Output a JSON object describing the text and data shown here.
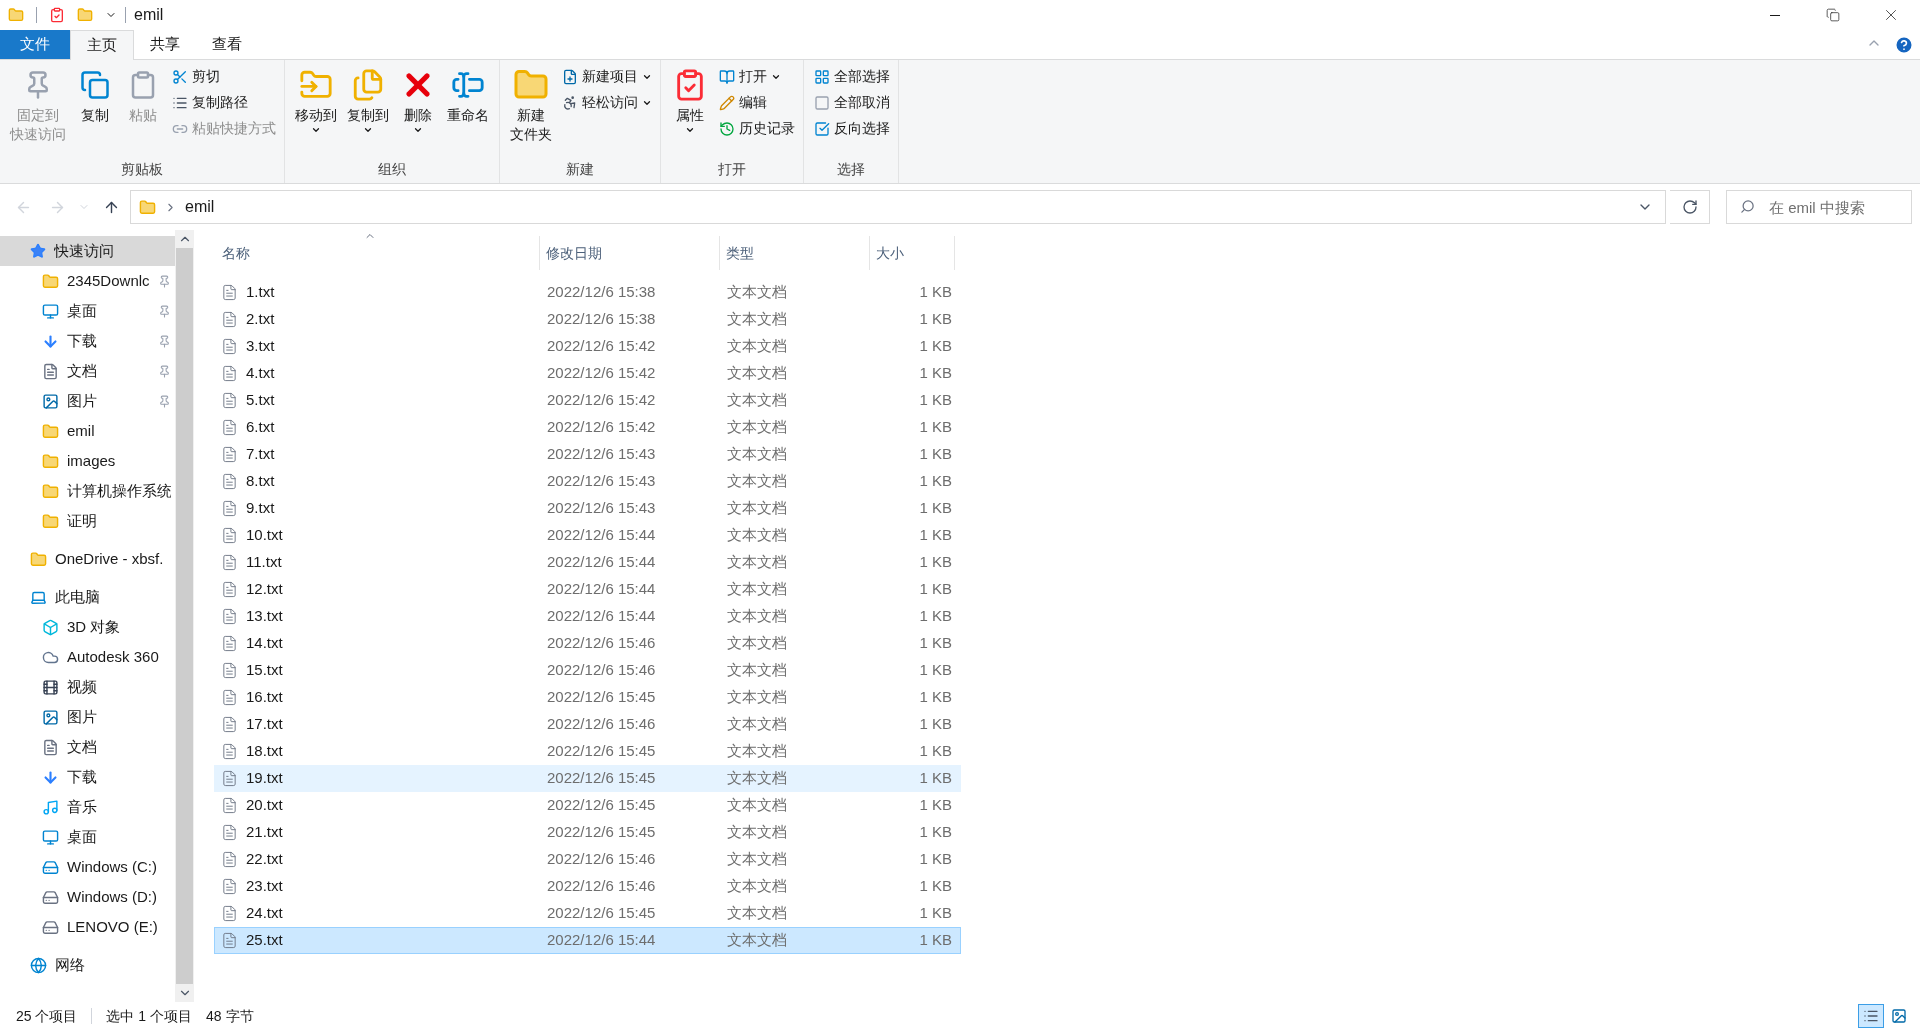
{
  "window": {
    "title": "emil"
  },
  "tabs": [
    {
      "label": "文件",
      "kind": "file-menu",
      "selected": false
    },
    {
      "label": "主页",
      "kind": "tab",
      "selected": true
    },
    {
      "label": "共享",
      "kind": "tab",
      "selected": false
    },
    {
      "label": "查看",
      "kind": "tab",
      "selected": false
    }
  ],
  "ribbon": [
    {
      "label": "剪贴板",
      "items": [
        {
          "lines": [
            "固定到",
            "快速访问"
          ],
          "kind": "large",
          "disabled": true,
          "dropdown": false
        },
        {
          "lines": [
            "复制"
          ],
          "kind": "large",
          "disabled": false,
          "dropdown": false
        },
        {
          "lines": [
            "粘贴"
          ],
          "kind": "large",
          "disabled": true,
          "dropdown": false
        },
        {
          "label": "剪切",
          "kind": "small",
          "disabled": false,
          "dropdown": false
        },
        {
          "label": "复制路径",
          "kind": "small",
          "disabled": false,
          "dropdown": false
        },
        {
          "label": "粘贴快捷方式",
          "kind": "small",
          "disabled": true,
          "dropdown": false
        }
      ]
    },
    {
      "label": "组织",
      "items": [
        {
          "lines": [
            "移动到"
          ],
          "kind": "large",
          "disabled": false,
          "dropdown": true
        },
        {
          "lines": [
            "复制到"
          ],
          "kind": "large",
          "disabled": false,
          "dropdown": true
        },
        {
          "lines": [
            "删除"
          ],
          "kind": "large",
          "disabled": false,
          "dropdown": true
        },
        {
          "lines": [
            "重命名"
          ],
          "kind": "large",
          "disabled": false,
          "dropdown": false
        }
      ]
    },
    {
      "label": "新建",
      "items": [
        {
          "lines": [
            "新建",
            "文件夹"
          ],
          "kind": "large",
          "disabled": false,
          "dropdown": false
        },
        {
          "label": "新建项目",
          "kind": "small",
          "disabled": false,
          "dropdown": true
        },
        {
          "label": "轻松访问",
          "kind": "small",
          "disabled": false,
          "dropdown": true
        }
      ]
    },
    {
      "label": "打开",
      "items": [
        {
          "lines": [
            "属性"
          ],
          "kind": "large",
          "disabled": false,
          "dropdown": true
        },
        {
          "label": "打开",
          "kind": "small",
          "disabled": false,
          "dropdown": true
        },
        {
          "label": "编辑",
          "kind": "small",
          "disabled": false,
          "dropdown": false
        },
        {
          "label": "历史记录",
          "kind": "small",
          "disabled": false,
          "dropdown": false
        }
      ]
    },
    {
      "label": "选择",
      "items": [
        {
          "label": "全部选择",
          "kind": "small",
          "disabled": false,
          "dropdown": false
        },
        {
          "label": "全部取消",
          "kind": "small",
          "disabled": false,
          "dropdown": false
        },
        {
          "label": "反向选择",
          "kind": "small",
          "disabled": false,
          "dropdown": false
        }
      ]
    }
  ],
  "address": {
    "back_disabled": true,
    "forward_disabled": true,
    "path": [
      "emil"
    ]
  },
  "search": {
    "placeholder": "在 emil 中搜索"
  },
  "sidebar": [
    {
      "label": "快速访问",
      "kind": "star",
      "selected": true,
      "children": [
        {
          "label": "2345Downlc",
          "kind": "folder",
          "pinned": true,
          "selected": false
        },
        {
          "label": "桌面",
          "kind": "desktop",
          "pinned": true,
          "selected": false
        },
        {
          "label": "下载",
          "kind": "download",
          "pinned": true,
          "selected": false
        },
        {
          "label": "文档",
          "kind": "document",
          "pinned": true,
          "selected": false
        },
        {
          "label": "图片",
          "kind": "picture",
          "pinned": true,
          "selected": false
        },
        {
          "label": "emil",
          "kind": "folder",
          "pinned": false,
          "selected": false
        },
        {
          "label": "images",
          "kind": "folder",
          "pinned": false,
          "selected": false
        },
        {
          "label": "计算机操作系统",
          "kind": "folder",
          "pinned": false,
          "selected": false
        },
        {
          "label": "证明",
          "kind": "folder",
          "pinned": false,
          "selected": false
        }
      ]
    },
    {
      "label": "OneDrive - xbsf.",
      "kind": "folder",
      "selected": false
    },
    {
      "label": "此电脑",
      "kind": "pc",
      "selected": false,
      "children": [
        {
          "label": "3D 对象",
          "kind": "cube",
          "pinned": false,
          "selected": false
        },
        {
          "label": "Autodesk 360",
          "kind": "cloud",
          "pinned": false,
          "selected": false
        },
        {
          "label": "视频",
          "kind": "video",
          "pinned": false,
          "selected": false
        },
        {
          "label": "图片",
          "kind": "picture",
          "pinned": false,
          "selected": false
        },
        {
          "label": "文档",
          "kind": "document",
          "pinned": false,
          "selected": false
        },
        {
          "label": "下载",
          "kind": "download",
          "pinned": false,
          "selected": false
        },
        {
          "label": "音乐",
          "kind": "music",
          "pinned": false,
          "selected": false
        },
        {
          "label": "桌面",
          "kind": "desktop",
          "pinned": false,
          "selected": false
        },
        {
          "label": "Windows (C:)",
          "kind": "system-drive",
          "pinned": false,
          "selected": false
        },
        {
          "label": "Windows (D:)",
          "kind": "drive",
          "pinned": false,
          "selected": false
        },
        {
          "label": "LENOVO (E:)",
          "kind": "drive",
          "pinned": false,
          "selected": false
        }
      ]
    },
    {
      "label": "网络",
      "kind": "network",
      "selected": false
    }
  ],
  "table": {
    "columns": [
      {
        "label": "名称",
        "sorted": true
      },
      {
        "label": "修改日期",
        "sorted": false
      },
      {
        "label": "类型",
        "sorted": false
      },
      {
        "label": "大小",
        "sorted": false
      }
    ],
    "rows": [
      {
        "name": "1.txt",
        "date": "2022/12/6 15:38",
        "type": "文本文档",
        "size": "1 KB",
        "selected": false,
        "hovered": false
      },
      {
        "name": "2.txt",
        "date": "2022/12/6 15:38",
        "type": "文本文档",
        "size": "1 KB",
        "selected": false,
        "hovered": false
      },
      {
        "name": "3.txt",
        "date": "2022/12/6 15:42",
        "type": "文本文档",
        "size": "1 KB",
        "selected": false,
        "hovered": false
      },
      {
        "name": "4.txt",
        "date": "2022/12/6 15:42",
        "type": "文本文档",
        "size": "1 KB",
        "selected": false,
        "hovered": false
      },
      {
        "name": "5.txt",
        "date": "2022/12/6 15:42",
        "type": "文本文档",
        "size": "1 KB",
        "selected": false,
        "hovered": false
      },
      {
        "name": "6.txt",
        "date": "2022/12/6 15:42",
        "type": "文本文档",
        "size": "1 KB",
        "selected": false,
        "hovered": false
      },
      {
        "name": "7.txt",
        "date": "2022/12/6 15:43",
        "type": "文本文档",
        "size": "1 KB",
        "selected": false,
        "hovered": false
      },
      {
        "name": "8.txt",
        "date": "2022/12/6 15:43",
        "type": "文本文档",
        "size": "1 KB",
        "selected": false,
        "hovered": false
      },
      {
        "name": "9.txt",
        "date": "2022/12/6 15:43",
        "type": "文本文档",
        "size": "1 KB",
        "selected": false,
        "hovered": false
      },
      {
        "name": "10.txt",
        "date": "2022/12/6 15:44",
        "type": "文本文档",
        "size": "1 KB",
        "selected": false,
        "hovered": false
      },
      {
        "name": "11.txt",
        "date": "2022/12/6 15:44",
        "type": "文本文档",
        "size": "1 KB",
        "selected": false,
        "hovered": false
      },
      {
        "name": "12.txt",
        "date": "2022/12/6 15:44",
        "type": "文本文档",
        "size": "1 KB",
        "selected": false,
        "hovered": false
      },
      {
        "name": "13.txt",
        "date": "2022/12/6 15:44",
        "type": "文本文档",
        "size": "1 KB",
        "selected": false,
        "hovered": false
      },
      {
        "name": "14.txt",
        "date": "2022/12/6 15:46",
        "type": "文本文档",
        "size": "1 KB",
        "selected": false,
        "hovered": false
      },
      {
        "name": "15.txt",
        "date": "2022/12/6 15:46",
        "type": "文本文档",
        "size": "1 KB",
        "selected": false,
        "hovered": false
      },
      {
        "name": "16.txt",
        "date": "2022/12/6 15:45",
        "type": "文本文档",
        "size": "1 KB",
        "selected": false,
        "hovered": false
      },
      {
        "name": "17.txt",
        "date": "2022/12/6 15:46",
        "type": "文本文档",
        "size": "1 KB",
        "selected": false,
        "hovered": false
      },
      {
        "name": "18.txt",
        "date": "2022/12/6 15:45",
        "type": "文本文档",
        "size": "1 KB",
        "selected": false,
        "hovered": false
      },
      {
        "name": "19.txt",
        "date": "2022/12/6 15:45",
        "type": "文本文档",
        "size": "1 KB",
        "selected": false,
        "hovered": true
      },
      {
        "name": "20.txt",
        "date": "2022/12/6 15:45",
        "type": "文本文档",
        "size": "1 KB",
        "selected": false,
        "hovered": false
      },
      {
        "name": "21.txt",
        "date": "2022/12/6 15:45",
        "type": "文本文档",
        "size": "1 KB",
        "selected": false,
        "hovered": false
      },
      {
        "name": "22.txt",
        "date": "2022/12/6 15:46",
        "type": "文本文档",
        "size": "1 KB",
        "selected": false,
        "hovered": false
      },
      {
        "name": "23.txt",
        "date": "2022/12/6 15:46",
        "type": "文本文档",
        "size": "1 KB",
        "selected": false,
        "hovered": false
      },
      {
        "name": "24.txt",
        "date": "2022/12/6 15:45",
        "type": "文本文档",
        "size": "1 KB",
        "selected": false,
        "hovered": false
      },
      {
        "name": "25.txt",
        "date": "2022/12/6 15:44",
        "type": "文本文档",
        "size": "1 KB",
        "selected": true,
        "hovered": false
      }
    ]
  },
  "status_bar": {
    "count": "25 个项目",
    "selection": "选中 1 个项目",
    "size": "48 字节"
  },
  "views": [
    {
      "selected": true
    },
    {
      "selected": false
    }
  ]
}
